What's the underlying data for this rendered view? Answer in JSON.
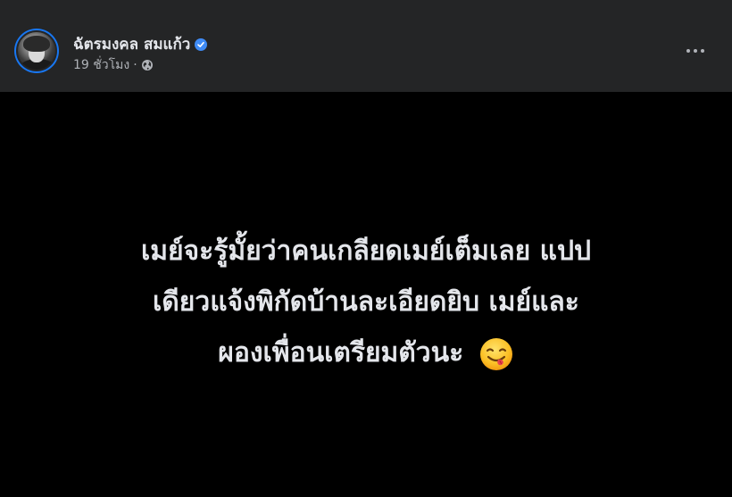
{
  "post": {
    "author": "ฉัตรมงคล สมแก้ว",
    "time": "19 ชั่วโมง",
    "separator": "·",
    "audience_icon": "globe-icon",
    "verified_icon": "verified-badge-icon",
    "more_icon": "more-options-icon",
    "lines": [
      "เมย์จะรู้มั้ยว่าคนเกลียดเมย์เต็มเลย แปป",
      "เดียวแจ้งพิกัดบ้านละเอียดยิบ เมย์และ",
      "ผองเพื่อนเตรียมตัวนะ"
    ],
    "emoji": "smiling-face-tongue-emoji"
  },
  "colors": {
    "header_bg": "#242526",
    "body_bg": "#000000",
    "text_primary": "#e4e6eb",
    "text_secondary": "#b0b3b8",
    "verified_blue": "#3f8bf5",
    "avatar_ring": "#1877f2"
  }
}
